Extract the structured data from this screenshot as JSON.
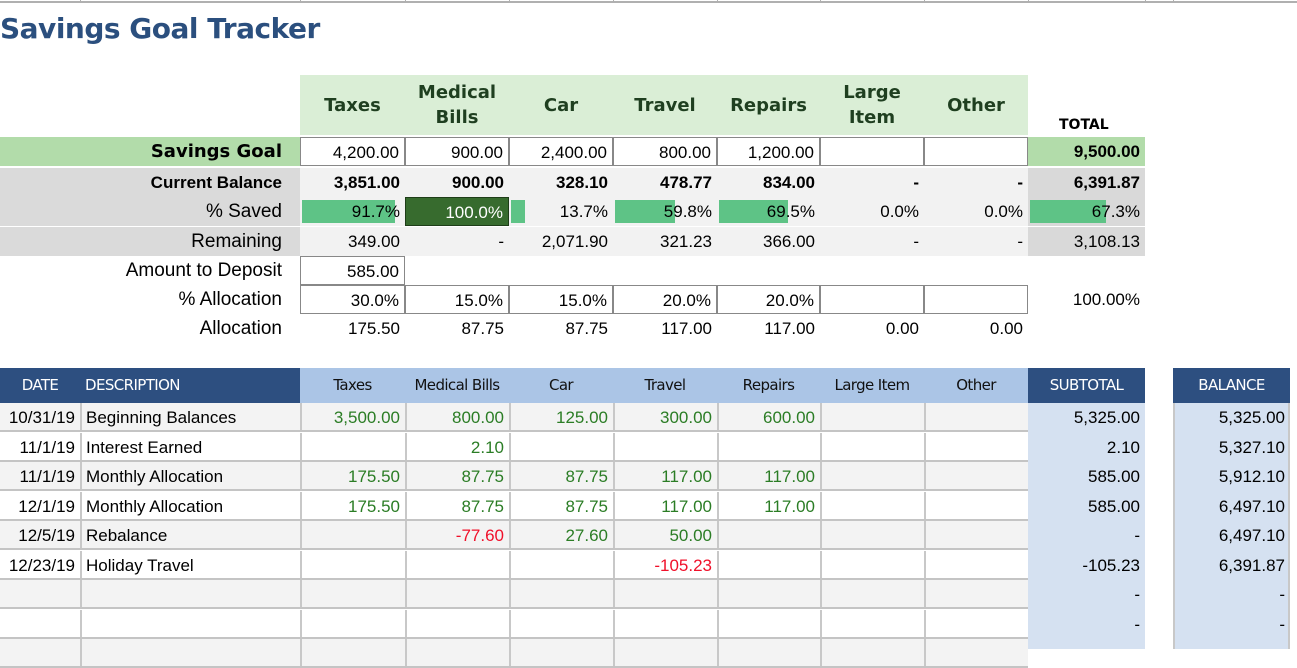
{
  "title": "Savings Goal Tracker",
  "categories": [
    "Taxes",
    "Medical Bills",
    "Car",
    "Travel",
    "Repairs",
    "Large Item",
    "Other"
  ],
  "category_headers": [
    [
      "Taxes"
    ],
    [
      "Medical",
      "Bills"
    ],
    [
      "Car"
    ],
    [
      "Travel"
    ],
    [
      "Repairs"
    ],
    [
      "Large",
      "Item"
    ],
    [
      "Other"
    ]
  ],
  "total_label": "TOTAL",
  "summary": {
    "savings_goal": {
      "label": "Savings Goal",
      "values": [
        "4,200.00",
        "900.00",
        "2,400.00",
        "800.00",
        "1,200.00",
        "",
        ""
      ],
      "total": "9,500.00"
    },
    "current_balance": {
      "label": "Current Balance",
      "values": [
        "3,851.00",
        "900.00",
        "328.10",
        "478.77",
        "834.00",
        "-",
        "-"
      ],
      "total": "6,391.87"
    },
    "percent_saved": {
      "label": "% Saved",
      "values": [
        "91.7%",
        "100.0%",
        "13.7%",
        "59.8%",
        "69.5%",
        "0.0%",
        "0.0%"
      ],
      "fractions": [
        0.917,
        1.0,
        0.137,
        0.598,
        0.695,
        0,
        0
      ],
      "total": "67.3%",
      "total_fraction": 0.673
    },
    "remaining": {
      "label": "Remaining",
      "values": [
        "349.00",
        "-",
        "2,071.90",
        "321.23",
        "366.00",
        "-",
        "-"
      ],
      "total": "3,108.13"
    },
    "amount_to_deposit": {
      "label": "Amount to Deposit",
      "value": "585.00"
    },
    "percent_allocation": {
      "label": "% Allocation",
      "values": [
        "30.0%",
        "15.0%",
        "15.0%",
        "20.0%",
        "20.0%",
        "",
        ""
      ],
      "total": "100.00%"
    },
    "allocation": {
      "label": "Allocation",
      "values": [
        "175.50",
        "87.75",
        "87.75",
        "117.00",
        "117.00",
        "0.00",
        "0.00"
      ]
    }
  },
  "colors": {
    "title": "#2b4f7e",
    "header_green": "#daeed6",
    "goal_green": "#b2dcaa",
    "bar_green": "#5ec386",
    "selected_cell": "#376b2e",
    "navy": "#2d4f80",
    "light_blue": "#abc5e6",
    "subtotal_bg": "#d5e1f1",
    "positive": "#2b7d25",
    "negative": "#f0102a"
  },
  "transactions": {
    "headers": {
      "date": "DATE",
      "description": "DESCRIPTION",
      "subtotal": "SUBTOTAL",
      "balance": "BALANCE"
    },
    "category_headers": [
      "Taxes",
      "Medical Bills",
      "Car",
      "Travel",
      "Repairs",
      "Large Item",
      "Other"
    ],
    "rows": [
      {
        "date": "10/31/19",
        "description": "Beginning Balances",
        "amounts": [
          "3,500.00",
          "800.00",
          "125.00",
          "300.00",
          "600.00",
          "",
          ""
        ],
        "subtotal": "5,325.00",
        "balance": "5,325.00"
      },
      {
        "date": "11/1/19",
        "description": "Interest Earned",
        "amounts": [
          "",
          "2.10",
          "",
          "",
          "",
          "",
          ""
        ],
        "subtotal": "2.10",
        "balance": "5,327.10"
      },
      {
        "date": "11/1/19",
        "description": "Monthly Allocation",
        "amounts": [
          "175.50",
          "87.75",
          "87.75",
          "117.00",
          "117.00",
          "",
          ""
        ],
        "subtotal": "585.00",
        "balance": "5,912.10"
      },
      {
        "date": "12/1/19",
        "description": "Monthly Allocation",
        "amounts": [
          "175.50",
          "87.75",
          "87.75",
          "117.00",
          "117.00",
          "",
          ""
        ],
        "subtotal": "585.00",
        "balance": "6,497.10"
      },
      {
        "date": "12/5/19",
        "description": "Rebalance",
        "amounts": [
          "",
          "-77.60",
          "27.60",
          "50.00",
          "",
          "",
          ""
        ],
        "subtotal": "-",
        "balance": "6,497.10"
      },
      {
        "date": "12/23/19",
        "description": "Holiday Travel",
        "amounts": [
          "",
          "",
          "",
          "-105.23",
          "",
          "",
          ""
        ],
        "subtotal": "-105.23",
        "balance": "6,391.87"
      },
      {
        "date": "",
        "description": "",
        "amounts": [
          "",
          "",
          "",
          "",
          "",
          "",
          ""
        ],
        "subtotal": "-",
        "balance": "-"
      },
      {
        "date": "",
        "description": "",
        "amounts": [
          "",
          "",
          "",
          "",
          "",
          "",
          ""
        ],
        "subtotal": "-",
        "balance": "-"
      },
      {
        "date": "",
        "description": "",
        "amounts": [
          "",
          "",
          "",
          "",
          "",
          "",
          ""
        ],
        "subtotal": "",
        "balance": ""
      }
    ]
  }
}
